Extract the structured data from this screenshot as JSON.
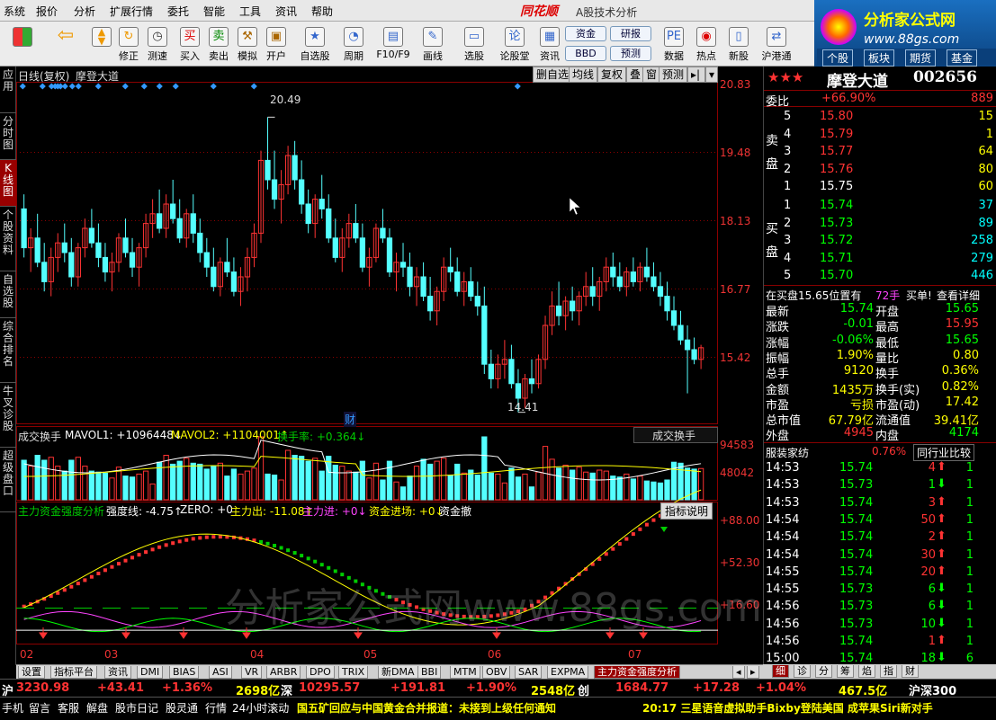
{
  "menu": [
    "系统",
    "报价",
    "分析",
    "扩展行情",
    "委托",
    "智能",
    "工具",
    "资讯",
    "帮助"
  ],
  "brand": "同花顺",
  "app_title": "A股技术分析",
  "site_logo": {
    "name": "分析家公式网",
    "url": "www.88gs.com"
  },
  "toolbar": [
    "修正",
    "测速",
    "买入",
    "卖出",
    "模拟",
    "开户",
    "自选股",
    "周期",
    "F10/F9",
    "画线",
    "选股",
    "论股堂",
    "资讯",
    "数据",
    "热点",
    "新股",
    "沪港通"
  ],
  "toolbar_small": [
    "资金",
    "研报",
    "BBD",
    "预测"
  ],
  "right_quick_tabs": [
    "个股",
    "板块",
    "期货",
    "基金"
  ],
  "left_nav": [
    "应用",
    "分时图",
    "K线图",
    "个股资料",
    "自选股",
    "综合排名",
    "牛叉诊股",
    "超级盘口"
  ],
  "chart_header": {
    "title": "日线(复权)",
    "stock": "摩登大道",
    "buttons": [
      "删自选",
      "均线",
      "复权",
      "叠",
      "窗",
      "预测"
    ]
  },
  "price_axis": [
    "20.83",
    "19.48",
    "18.13",
    "16.77",
    "15.42"
  ],
  "annotations": {
    "high": "20.49",
    "low": "14.41",
    "finance_mark": "财"
  },
  "vol_header": {
    "name": "成交换手",
    "mavol1": "MAVOL1: +1096448↓",
    "mavol2": "MAVOL2: +1104001↑",
    "turnover": "换手率: +0.364↓",
    "selector": "成交换手"
  },
  "vol_axis": [
    "94583",
    "48042"
  ],
  "ind_header": {
    "name": "主力资金强度分析",
    "strength": "强度线: -4.75↑",
    "zero": "ZERO: +0",
    "out": "主力出: -11.08↑",
    "in": "主力进: +0↓",
    "enter": "资金进场: +0↓",
    "scatter": "资金撤",
    "button": "指标说明"
  },
  "ind_axis": [
    "+88.00",
    "+52.30",
    "+16.60"
  ],
  "x_axis": [
    "02",
    "03",
    "04",
    "05",
    "06",
    "07"
  ],
  "watermark": "分析家公式网www.88gs.com",
  "bottom_tabs": [
    "设置",
    "指标平台",
    "资讯",
    "DMI",
    "BIAS",
    "ASI",
    "VR",
    "ARBR",
    "DPO",
    "TRIX",
    "新DMA",
    "BBI",
    "MTM",
    "OBV",
    "SAR",
    "EXPMA",
    "主力资金强度分析"
  ],
  "right_bottom_tabs": [
    "细",
    "诊",
    "分",
    "筹",
    "焰",
    "指",
    "财"
  ],
  "quote": {
    "stars": "★★★",
    "name": "摩登大道",
    "code": "002656",
    "wb_label": "委比",
    "wb_value": "+66.90%",
    "wb_diff": "889",
    "sell_label": "卖盘",
    "buy_label": "买盘",
    "sell": [
      {
        "lvl": "5",
        "price": "15.80",
        "vol": "15"
      },
      {
        "lvl": "4",
        "price": "15.79",
        "vol": "1"
      },
      {
        "lvl": "3",
        "price": "15.77",
        "vol": "64"
      },
      {
        "lvl": "2",
        "price": "15.76",
        "vol": "80"
      },
      {
        "lvl": "1",
        "price": "15.75",
        "vol": "60"
      }
    ],
    "buy": [
      {
        "lvl": "1",
        "price": "15.74",
        "vol": "37"
      },
      {
        "lvl": "2",
        "price": "15.73",
        "vol": "89"
      },
      {
        "lvl": "3",
        "price": "15.72",
        "vol": "258"
      },
      {
        "lvl": "4",
        "price": "15.71",
        "vol": "279"
      },
      {
        "lvl": "5",
        "price": "15.70",
        "vol": "446"
      }
    ],
    "position_note": "在买盘15.65位置有",
    "position_vol": "72手",
    "buy_link": "买单!",
    "detail_link": "查看详细",
    "stats": [
      {
        "l1": "最新",
        "v1": "15.74",
        "c1": "grn",
        "l2": "开盘",
        "v2": "15.65",
        "c2": "grn"
      },
      {
        "l1": "涨跌",
        "v1": "-0.01",
        "c1": "grn",
        "l2": "最高",
        "v2": "15.95",
        "c2": "red"
      },
      {
        "l1": "涨幅",
        "v1": "-0.06%",
        "c1": "grn",
        "l2": "最低",
        "v2": "15.65",
        "c2": "grn"
      },
      {
        "l1": "振幅",
        "v1": "1.90%",
        "c1": "yel",
        "l2": "量比",
        "v2": "0.80",
        "c2": "yel"
      },
      {
        "l1": "总手",
        "v1": "9120",
        "c1": "yel",
        "l2": "换手",
        "v2": "0.36%",
        "c2": "yel"
      },
      {
        "l1": "金额",
        "v1": "1435万",
        "c1": "yel",
        "l2": "换手(实)",
        "v2": "0.82%",
        "c2": "yel"
      },
      {
        "l1": "市盈",
        "v1": "亏损",
        "c1": "yel",
        "l2": "市盈(动)",
        "v2": "17.42",
        "c2": "yel"
      },
      {
        "l1": "总市值",
        "v1": "67.79亿",
        "c1": "yel",
        "l2": "流通值",
        "v2": "39.41亿",
        "c2": "yel"
      },
      {
        "l1": "外盘",
        "v1": "4945",
        "c1": "red",
        "l2": "内盘",
        "v2": "4174",
        "c2": "grn"
      }
    ],
    "sector": "服装家纺",
    "sector_pct": "0.76%",
    "peer_button": "同行业比较",
    "ticks": [
      {
        "t": "14:53",
        "p": "15.74",
        "v": "4",
        "d": "up",
        "n": "1"
      },
      {
        "t": "14:53",
        "p": "15.73",
        "v": "1",
        "d": "dn",
        "n": "1"
      },
      {
        "t": "14:53",
        "p": "15.74",
        "v": "3",
        "d": "up",
        "n": "1"
      },
      {
        "t": "14:54",
        "p": "15.74",
        "v": "50",
        "d": "up",
        "n": "1"
      },
      {
        "t": "14:54",
        "p": "15.74",
        "v": "2",
        "d": "up",
        "n": "1"
      },
      {
        "t": "14:54",
        "p": "15.74",
        "v": "30",
        "d": "up",
        "n": "1"
      },
      {
        "t": "14:55",
        "p": "15.74",
        "v": "20",
        "d": "up",
        "n": "1"
      },
      {
        "t": "14:55",
        "p": "15.73",
        "v": "6",
        "d": "dn",
        "n": "1"
      },
      {
        "t": "14:56",
        "p": "15.73",
        "v": "6",
        "d": "dn",
        "n": "1"
      },
      {
        "t": "14:56",
        "p": "15.73",
        "v": "10",
        "d": "dn",
        "n": "1"
      },
      {
        "t": "14:56",
        "p": "15.74",
        "v": "1",
        "d": "up",
        "n": "1"
      },
      {
        "t": "15:00",
        "p": "15.74",
        "v": "18",
        "d": "dn",
        "n": "6"
      }
    ]
  },
  "ticker": {
    "sh_label": "沪",
    "sh_index": "3230.98",
    "sh_chg": "+43.41",
    "sh_pct": "+1.36%",
    "sh_amt": "2698亿",
    "sz_label": "深",
    "sz_index": "10295.57",
    "sz_chg": "+191.81",
    "sz_pct": "+1.90%",
    "sz_amt": "2548亿",
    "cy_label": "创",
    "cy_index": "1684.77",
    "cy_chg": "+17.28",
    "cy_pct": "+1.04%",
    "hs_amt": "467.5亿",
    "hs_label": "沪深300"
  },
  "status": {
    "items": [
      "手机",
      "留言",
      "客服",
      "解盘",
      "股市日记",
      "股灵通",
      "行情",
      "24小时滚动"
    ],
    "news1": "国五矿回应与中国黄金合并报道：未接到上级任何通知",
    "news2": "20:17 三星语音虚拟助手Bixby登陆美国 成苹果Siri新对手"
  },
  "colors": {
    "up": "#ff3333",
    "down": "#54ffff",
    "grid": "#8b0000",
    "accent": "#990000"
  },
  "chart_data": {
    "type": "candlestick",
    "price_range": [
      14.2,
      21.2
    ],
    "ohlc": [
      [
        18.6,
        18.9,
        17.6,
        17.8
      ],
      [
        17.8,
        18.2,
        17.3,
        18.0
      ],
      [
        18.0,
        18.5,
        17.4,
        17.5
      ],
      [
        17.5,
        17.9,
        16.9,
        17.1
      ],
      [
        17.1,
        17.8,
        16.8,
        17.6
      ],
      [
        17.6,
        18.1,
        17.3,
        17.9
      ],
      [
        17.9,
        18.3,
        17.5,
        17.7
      ],
      [
        17.7,
        18.0,
        17.0,
        17.2
      ],
      [
        17.2,
        17.9,
        17.0,
        17.8
      ],
      [
        17.8,
        18.4,
        17.6,
        18.2
      ],
      [
        18.2,
        18.6,
        17.8,
        17.9
      ],
      [
        17.9,
        18.3,
        17.4,
        17.6
      ],
      [
        17.6,
        17.9,
        17.1,
        17.3
      ],
      [
        17.3,
        17.7,
        16.9,
        17.5
      ],
      [
        17.5,
        18.1,
        17.3,
        18.0
      ],
      [
        18.0,
        18.4,
        17.6,
        17.7
      ],
      [
        17.7,
        18.0,
        17.2,
        17.4
      ],
      [
        17.4,
        17.9,
        17.0,
        17.8
      ],
      [
        17.8,
        18.5,
        17.6,
        18.3
      ],
      [
        18.3,
        18.8,
        18.0,
        18.5
      ],
      [
        18.5,
        19.0,
        18.1,
        18.2
      ],
      [
        18.2,
        18.9,
        18.0,
        18.7
      ],
      [
        18.7,
        19.2,
        18.3,
        18.4
      ],
      [
        18.4,
        18.8,
        17.9,
        18.0
      ],
      [
        18.0,
        18.6,
        17.8,
        18.5
      ],
      [
        18.5,
        18.9,
        17.9,
        18.1
      ],
      [
        18.1,
        18.4,
        17.5,
        17.7
      ],
      [
        17.7,
        18.0,
        17.2,
        17.4
      ],
      [
        17.4,
        17.8,
        16.9,
        17.0
      ],
      [
        17.0,
        17.6,
        16.8,
        17.5
      ],
      [
        17.5,
        18.0,
        17.2,
        17.3
      ],
      [
        17.3,
        17.6,
        16.8,
        16.9
      ],
      [
        16.9,
        17.4,
        16.6,
        17.2
      ],
      [
        17.2,
        17.8,
        16.9,
        17.6
      ],
      [
        17.6,
        18.3,
        17.4,
        18.1
      ],
      [
        18.1,
        19.8,
        17.9,
        19.6
      ],
      [
        19.6,
        20.49,
        19.0,
        19.2
      ],
      [
        19.2,
        19.8,
        18.6,
        18.8
      ],
      [
        18.8,
        19.4,
        18.3,
        19.1
      ],
      [
        19.1,
        19.9,
        18.9,
        19.7
      ],
      [
        19.7,
        20.0,
        19.0,
        19.2
      ],
      [
        19.2,
        19.6,
        18.5,
        18.7
      ],
      [
        18.7,
        19.0,
        18.1,
        18.3
      ],
      [
        18.3,
        18.9,
        18.0,
        18.8
      ],
      [
        18.8,
        19.3,
        18.4,
        18.6
      ],
      [
        18.6,
        18.9,
        17.9,
        18.0
      ],
      [
        18.0,
        18.4,
        17.5,
        17.6
      ],
      [
        17.6,
        18.2,
        17.3,
        18.0
      ],
      [
        18.0,
        18.5,
        17.8,
        18.3
      ],
      [
        18.3,
        18.7,
        17.9,
        18.0
      ],
      [
        18.0,
        18.3,
        17.3,
        17.4
      ],
      [
        17.4,
        17.8,
        17.0,
        17.6
      ],
      [
        17.6,
        18.3,
        17.5,
        18.2
      ],
      [
        18.2,
        18.6,
        17.9,
        18.0
      ],
      [
        18.0,
        18.2,
        17.2,
        17.3
      ],
      [
        17.3,
        17.7,
        16.9,
        17.5
      ],
      [
        17.5,
        17.9,
        17.2,
        17.4
      ],
      [
        17.4,
        17.7,
        16.8,
        17.0
      ],
      [
        17.0,
        17.4,
        16.6,
        17.2
      ],
      [
        17.2,
        17.5,
        16.7,
        16.8
      ],
      [
        16.8,
        17.2,
        16.3,
        16.5
      ],
      [
        16.5,
        17.0,
        16.2,
        16.9
      ],
      [
        16.9,
        17.6,
        16.7,
        17.4
      ],
      [
        17.4,
        17.8,
        17.1,
        17.3
      ],
      [
        17.3,
        17.6,
        16.8,
        16.9
      ],
      [
        16.9,
        17.3,
        16.6,
        17.1
      ],
      [
        17.1,
        17.4,
        16.7,
        16.8
      ],
      [
        16.8,
        17.1,
        16.4,
        16.6
      ],
      [
        16.6,
        17.0,
        15.2,
        15.4
      ],
      [
        15.4,
        15.7,
        14.9,
        15.1
      ],
      [
        15.1,
        15.6,
        14.9,
        15.4
      ],
      [
        15.4,
        15.9,
        15.1,
        15.5
      ],
      [
        15.5,
        15.8,
        14.9,
        15.0
      ],
      [
        15.0,
        15.3,
        14.41,
        14.7
      ],
      [
        14.7,
        15.2,
        14.5,
        15.1
      ],
      [
        15.1,
        15.5,
        14.8,
        15.0
      ],
      [
        15.0,
        15.6,
        14.9,
        15.5
      ],
      [
        15.5,
        16.4,
        15.3,
        16.2
      ],
      [
        16.2,
        16.9,
        16.0,
        16.6
      ],
      [
        16.6,
        17.1,
        16.2,
        16.4
      ],
      [
        16.4,
        16.8,
        16.1,
        16.7
      ],
      [
        16.7,
        17.0,
        16.3,
        16.5
      ],
      [
        16.5,
        16.9,
        16.2,
        16.8
      ],
      [
        16.8,
        17.3,
        16.6,
        17.0
      ],
      [
        17.0,
        17.4,
        16.6,
        16.8
      ],
      [
        16.8,
        17.2,
        16.5,
        17.1
      ],
      [
        17.1,
        17.6,
        16.9,
        17.4
      ],
      [
        17.4,
        17.7,
        17.0,
        17.2
      ],
      [
        17.2,
        17.5,
        16.9,
        17.0
      ],
      [
        17.0,
        17.4,
        16.8,
        17.3
      ],
      [
        17.3,
        17.6,
        17.0,
        17.1
      ],
      [
        17.1,
        17.5,
        16.9,
        17.4
      ],
      [
        17.4,
        17.8,
        17.1,
        17.2
      ],
      [
        17.2,
        17.5,
        16.9,
        17.0
      ],
      [
        17.0,
        17.3,
        16.6,
        16.8
      ],
      [
        16.8,
        17.1,
        16.3,
        16.5
      ],
      [
        16.5,
        16.8,
        16.1,
        16.2
      ],
      [
        16.2,
        16.5,
        15.8,
        15.9
      ],
      [
        15.9,
        16.2,
        14.8,
        15.7
      ],
      [
        15.7,
        15.95,
        15.4,
        15.5
      ],
      [
        15.5,
        15.8,
        15.3,
        15.74
      ]
    ]
  }
}
